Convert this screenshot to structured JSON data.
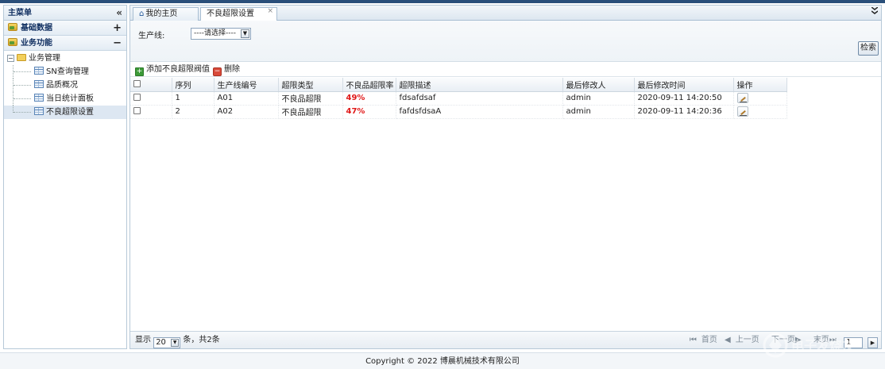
{
  "sidebar": {
    "title": "主菜单",
    "collapse_glyph": "«",
    "groups": [
      {
        "label": "基础数据",
        "toggle": "+"
      },
      {
        "label": "业务功能",
        "toggle": "−"
      }
    ],
    "folder": {
      "label": "业务管理",
      "toggle": "−"
    },
    "items": [
      {
        "label": "SN查询管理",
        "icon": "grid-icon"
      },
      {
        "label": "品质概况",
        "icon": "grid-icon"
      },
      {
        "label": "当日统计面板",
        "icon": "grid-icon"
      },
      {
        "label": "不良超限设置",
        "icon": "grid-icon",
        "active": true
      }
    ]
  },
  "tabs": {
    "home": {
      "label": "我的主页",
      "icon": "home-icon"
    },
    "active": {
      "label": "不良超限设置",
      "close": "×"
    },
    "scroll_glyph": "▼"
  },
  "filter": {
    "line_label": "生产线:",
    "line_select_value": "----请选择----",
    "search_label": "检索"
  },
  "toolbar": {
    "add_label": "添加不良超限阀值",
    "delete_label": "删除"
  },
  "table": {
    "columns": [
      "序列",
      "生产线编号",
      "超限类型",
      "不良品超限率",
      "超限描述",
      "最后修改人",
      "最后修改时间",
      "操作"
    ],
    "rows": [
      {
        "seq": "1",
        "line": "A01",
        "type": "不良品超限",
        "rate": "49%",
        "desc": "fdsafdsaf",
        "modifier": "admin",
        "time": "2020-09-11 14:20:50"
      },
      {
        "seq": "2",
        "line": "A02",
        "type": "不良品超限",
        "rate": "47%",
        "desc": "fafdsfdsaA",
        "modifier": "admin",
        "time": "2020-09-11 14:20:36"
      }
    ]
  },
  "pager": {
    "show_label": "显示",
    "page_size": "20",
    "summary": "条，共2条",
    "first": "首页",
    "prev": "上一页",
    "next": "下一页",
    "last": "末页",
    "current_page": "1"
  },
  "footer": {
    "copyright": "Copyright © 2022 博晨机械技术有限公司"
  },
  "watermark": {
    "text": "电子发烧友"
  },
  "colors": {
    "accent": "#2a4f7a",
    "rate_red": "#e01818",
    "border": "#b7c9d8"
  }
}
